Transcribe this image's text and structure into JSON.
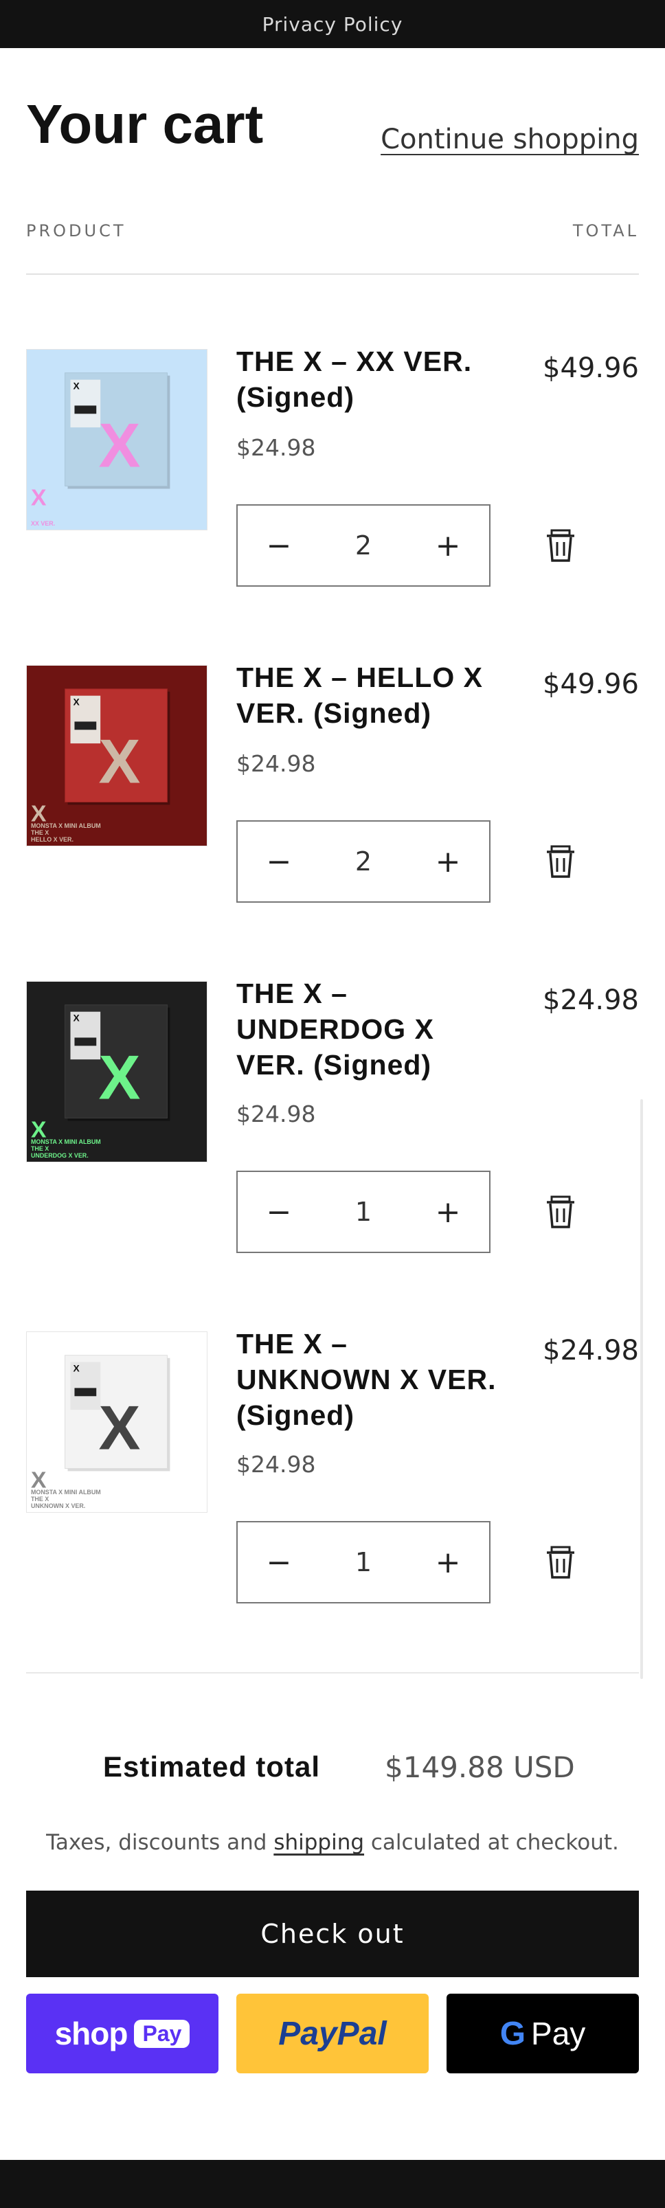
{
  "topbar": {
    "text": "Privacy Policy"
  },
  "header": {
    "title": "Your cart",
    "continue_label": "Continue shopping"
  },
  "columns": {
    "product": "PRODUCT",
    "total": "TOTAL"
  },
  "items": [
    {
      "name": "THE X – XX VER. (Signed)",
      "price": "$24.98",
      "quantity": "2",
      "total": "$49.96",
      "art": {
        "bg": "#c6e3fa",
        "x_color": "#f08ee0",
        "lines": [
          "",
          "",
          "XX VER."
        ]
      }
    },
    {
      "name": "THE X – HELLO X VER. (Signed)",
      "price": "$24.98",
      "quantity": "2",
      "total": "$49.96",
      "art": {
        "bg": "#6e1412",
        "x_color": "#cdb8a6",
        "lines": [
          "MONSTA X MINI ALBUM",
          "THE X",
          "HELLO X VER."
        ]
      }
    },
    {
      "name": "THE X – UNDERDOG X VER. (Signed)",
      "price": "$24.98",
      "quantity": "1",
      "total": "$24.98",
      "art": {
        "bg": "#1e1e1e",
        "x_color": "#6df28a",
        "lines": [
          "MONSTA X MINI ALBUM",
          "THE X",
          "UNDERDOG X VER."
        ]
      }
    },
    {
      "name": "THE X – UNKNOWN X VER. (Signed)",
      "price": "$24.98",
      "quantity": "1",
      "total": "$24.98",
      "art": {
        "bg": "#ffffff",
        "x_color": "#444444",
        "lines": [
          "MONSTA X MINI ALBUM",
          "THE X",
          "UNKNOWN X VER."
        ]
      }
    }
  ],
  "summary": {
    "estimated_label": "Estimated total",
    "estimated_value": "$149.88 USD",
    "tax_prefix": "Taxes, discounts and ",
    "tax_link": "shipping",
    "tax_suffix": " calculated at checkout.",
    "checkout_label": "Check out"
  },
  "payments": {
    "shop": {
      "word": "shop",
      "badge": "Pay",
      "color": "#5a31f4"
    },
    "paypal": {
      "word": "PayPal",
      "color": "#ffc439"
    },
    "gpay": {
      "g": "G",
      "word": "Pay",
      "color": "#000000"
    }
  },
  "icons": {
    "minus": "minus-icon",
    "plus": "plus-icon",
    "remove": "trash-icon"
  }
}
